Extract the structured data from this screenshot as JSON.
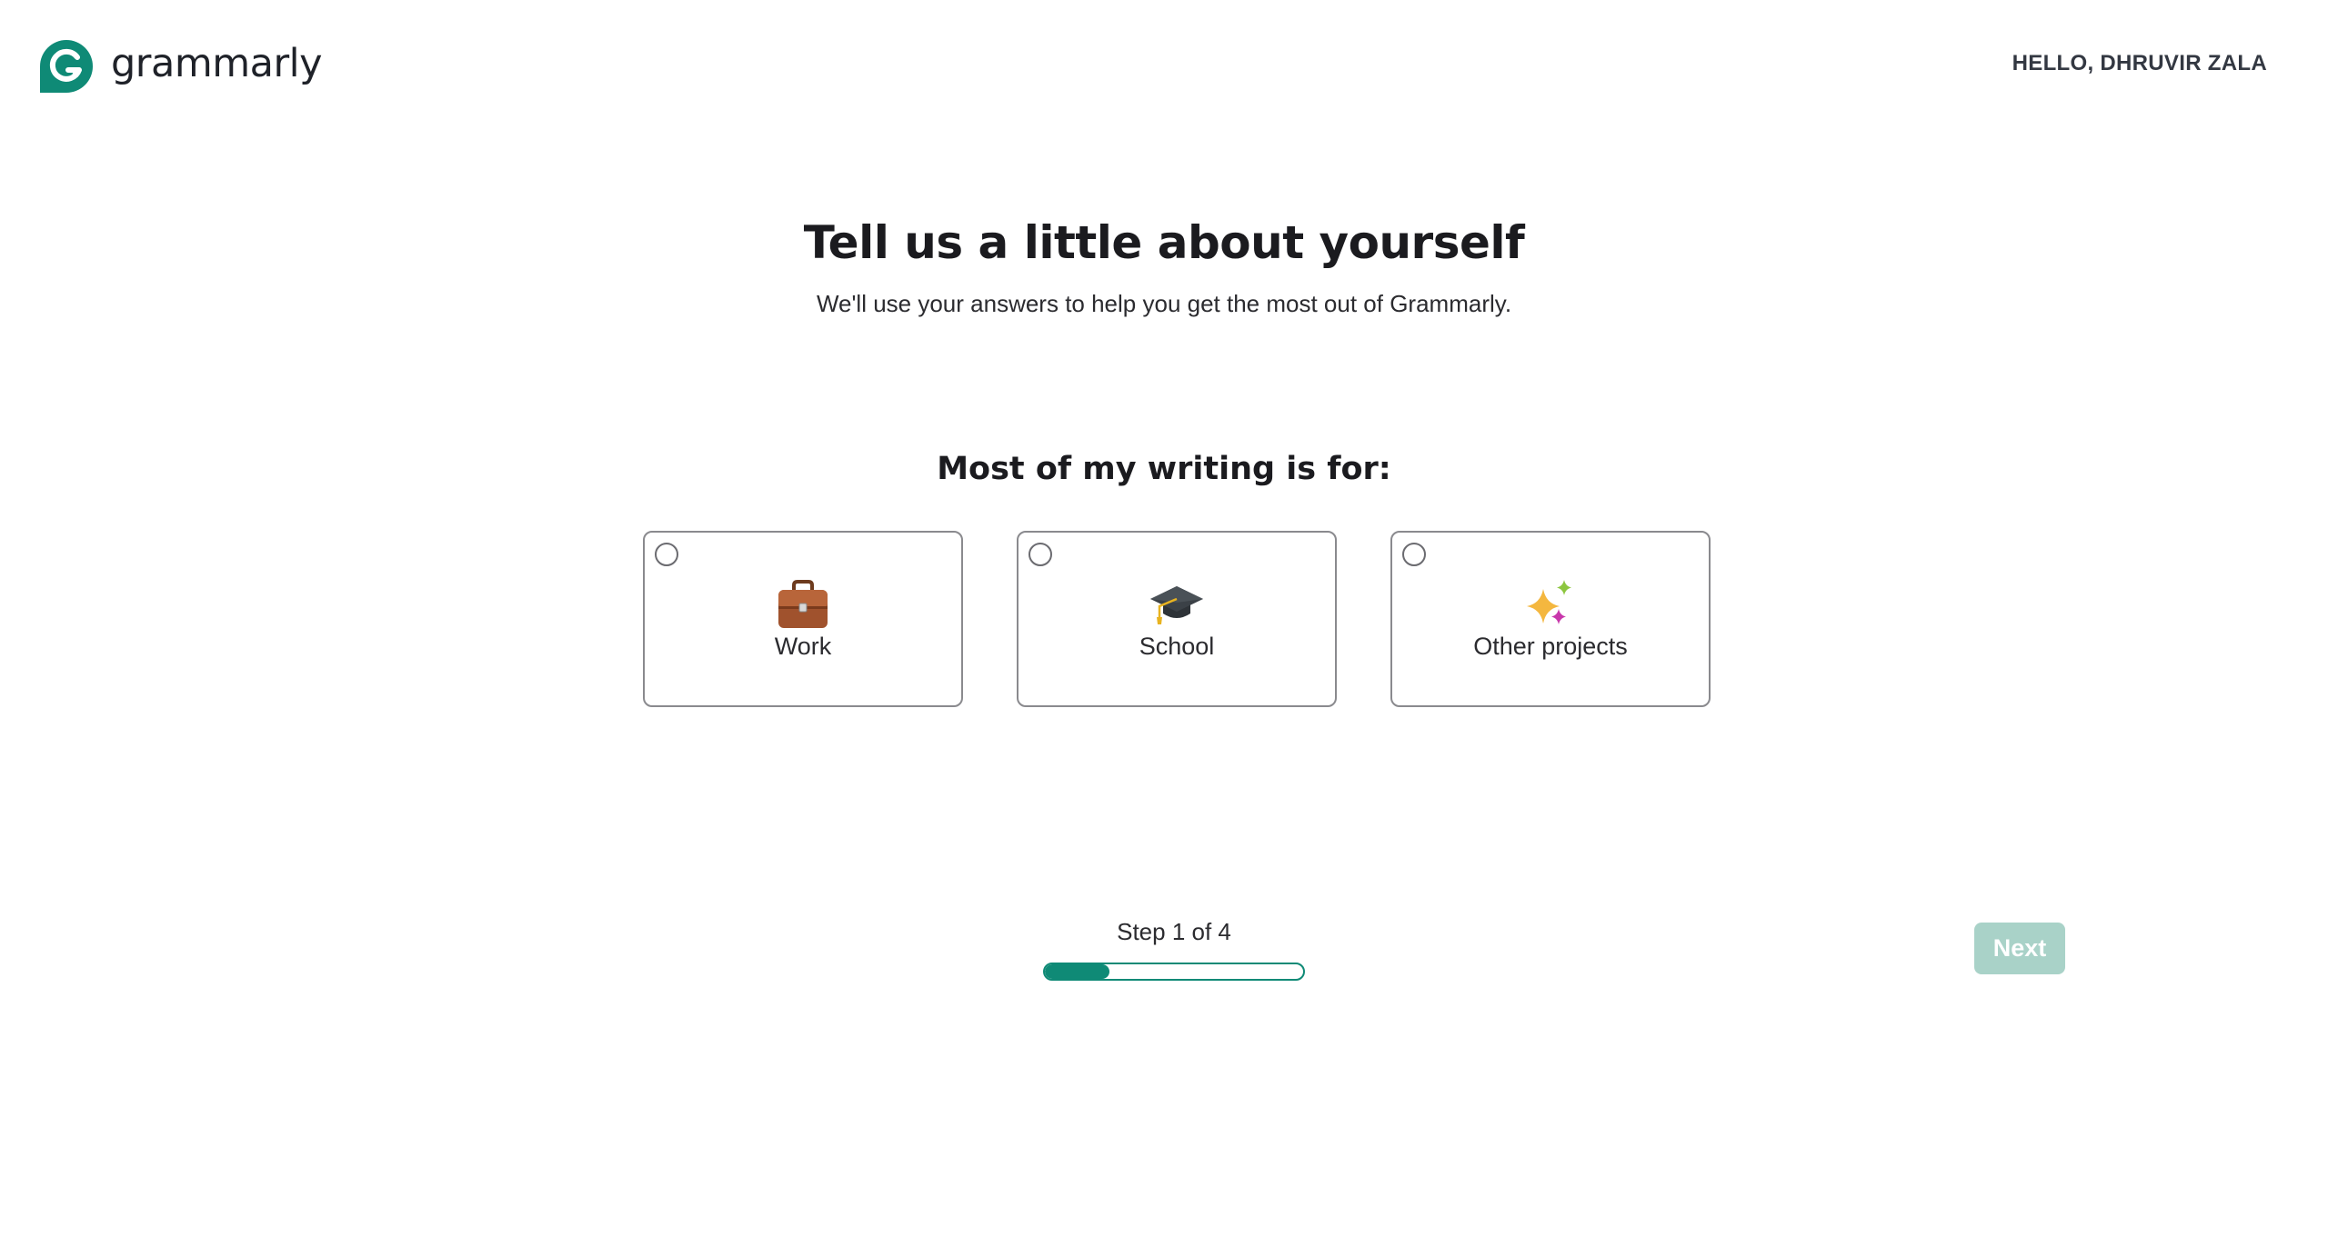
{
  "header": {
    "logo_text": "grammarly",
    "greeting": "HELLO, DHRUVIR ZALA"
  },
  "intro": {
    "title": "Tell us a little about yourself",
    "subtitle": "We'll use your answers to help you get the most out of Grammarly."
  },
  "question": {
    "label": "Most of my writing is for:",
    "options": [
      {
        "label": "Work",
        "icon": "briefcase-icon",
        "selected": false
      },
      {
        "label": "School",
        "icon": "graduation-cap-icon",
        "selected": false
      },
      {
        "label": "Other projects",
        "icon": "sparkles-icon",
        "selected": false
      }
    ]
  },
  "progress": {
    "step_label": "Step 1 of 4",
    "fraction": 0.25
  },
  "actions": {
    "next_label": "Next",
    "next_enabled": false
  },
  "colors": {
    "brand": "#0f8a76",
    "next_disabled": "#a9d2c8"
  }
}
